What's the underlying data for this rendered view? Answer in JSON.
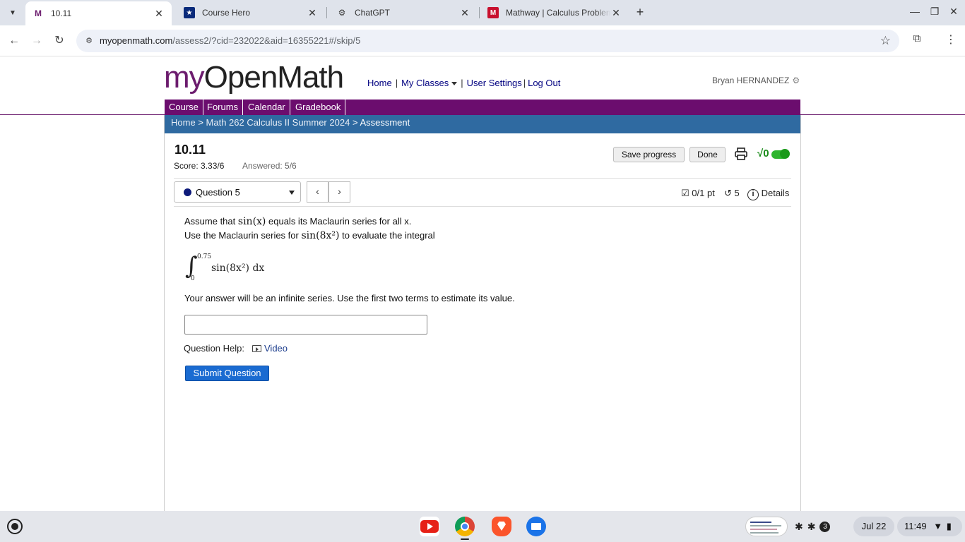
{
  "browser": {
    "tabs": [
      {
        "title": "10.11",
        "favicon": "gmail-m-icon",
        "active": true
      },
      {
        "title": "Course Hero",
        "favicon": "course-hero-star-icon",
        "active": false
      },
      {
        "title": "ChatGPT",
        "favicon": "chatgpt-icon",
        "active": false
      },
      {
        "title": "Mathway | Calculus Problem S",
        "favicon": "mathway-icon",
        "active": false
      }
    ],
    "url_host": "myopenmath.com",
    "url_path": "/assess2/?cid=232022&aid=16355221#/skip/5"
  },
  "site": {
    "logo_my": "my",
    "logo_rest": "OpenMath",
    "nav": [
      "Home",
      "My Classes",
      "User Settings",
      "Log Out"
    ],
    "user_name": "Bryan HERNANDEZ",
    "menu": [
      "Course",
      "Forums",
      "Calendar",
      "Gradebook"
    ],
    "breadcrumb": {
      "home": "Home",
      "course": "Math 262 Calculus II Summer 2024",
      "current": "Assessment",
      "separator": ">"
    }
  },
  "assessment": {
    "title": "10.11",
    "score": "Score: 3.33/6",
    "answered": "Answered: 5/6",
    "save_label": "Save progress",
    "done_label": "Done",
    "question_select": "Question 5",
    "points": "0/1 pt",
    "retries": "5",
    "details": "Details"
  },
  "question": {
    "line1_prefix": "Assume that",
    "line1_func": "sin(x)",
    "line1_suffix": "equals its Maclaurin series for all x.",
    "line2_prefix": "Use the Maclaurin series for",
    "line2_func": "sin(8x²)",
    "line2_suffix": "to evaluate the integral",
    "integral_upper": "0.75",
    "integral_lower": "0",
    "integrand": "sin(8x²) dx",
    "instruction": "Your answer will be an infinite series. Use the first two terms to estimate its value.",
    "answer_value": "",
    "help_label": "Question Help:",
    "video_label": "Video",
    "submit_label": "Submit Question"
  },
  "shelf": {
    "notification_count": "3",
    "date": "Jul 22",
    "time": "11:49"
  },
  "colors": {
    "brand_purple": "#6b0d6e",
    "breadcrumb_blue": "#2f6aa1",
    "link_navy": "#000080",
    "submit_blue": "#1a6bd1",
    "toggle_green": "#2db52d"
  }
}
